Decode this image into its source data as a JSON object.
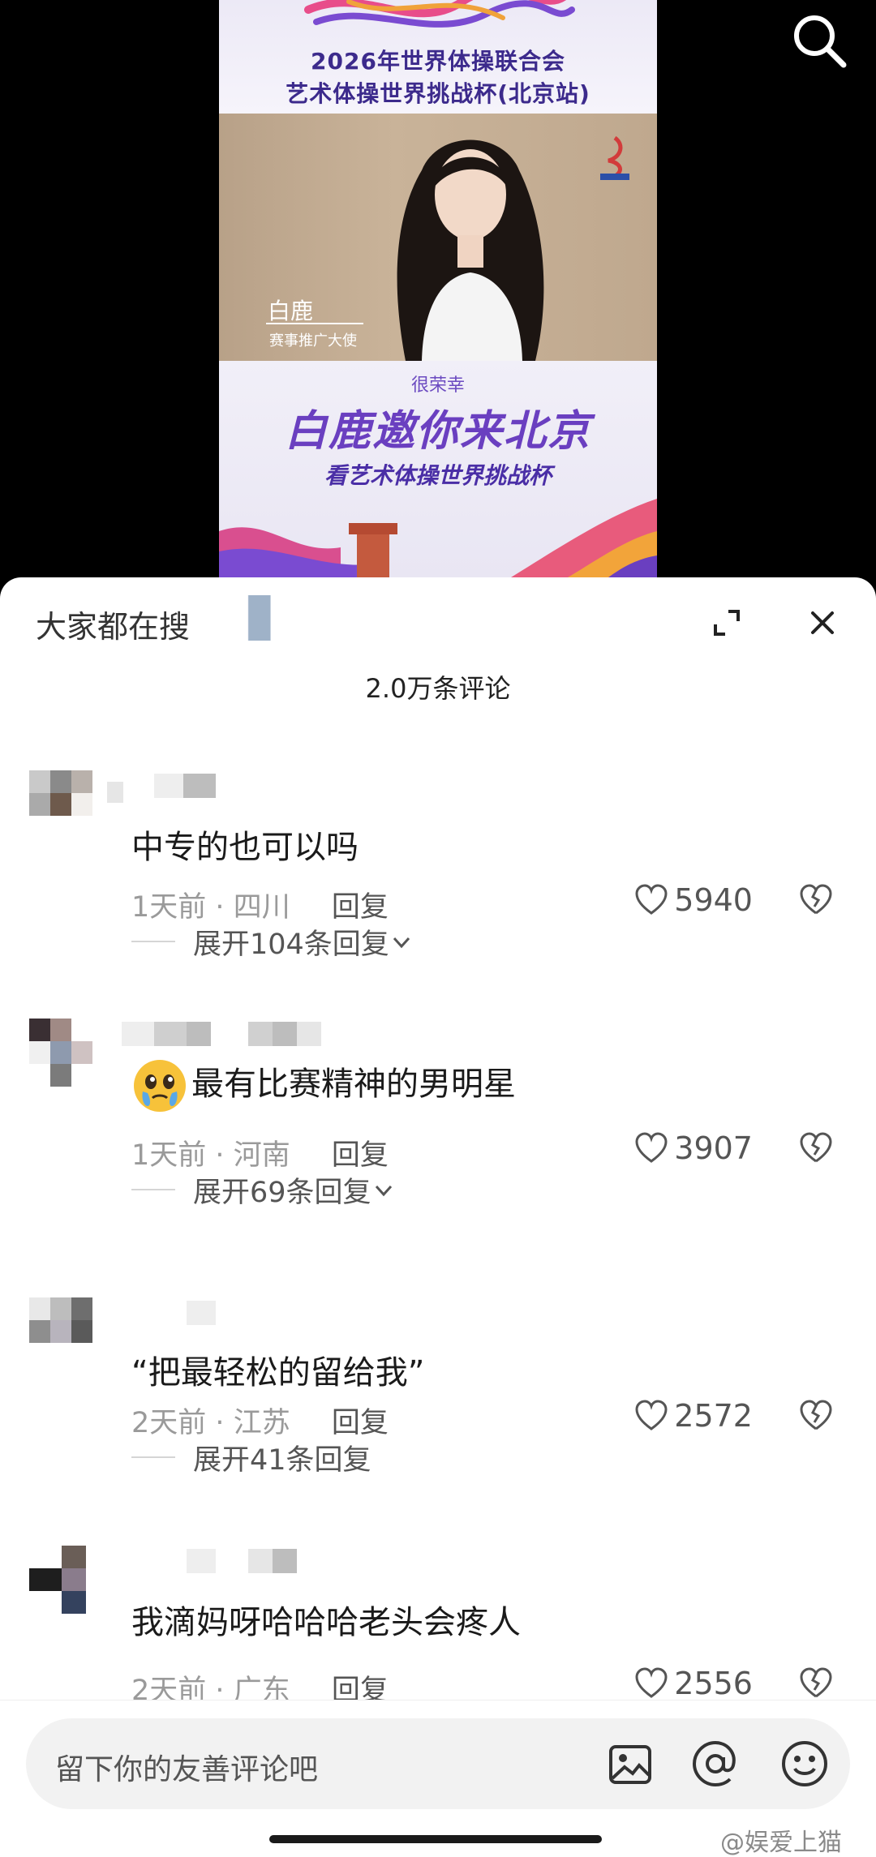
{
  "poster": {
    "title_line1": "2026年世界体操联合会",
    "title_line2": "艺术体操世界挑战杯(北京站)",
    "person_name": "白鹿",
    "person_role": "赛事推广大使",
    "invite_small": "很荣幸",
    "invite_big": "白鹿邀你来北京",
    "invite_mid": "看艺术体操世界挑战杯"
  },
  "sheet": {
    "hot_search_label": "大家都在搜",
    "comment_count": "2.0万条评论"
  },
  "comments": [
    {
      "text": "中专的也可以吗",
      "time": "1天前",
      "location": "四川",
      "reply_label": "回复",
      "likes": "5940",
      "expand_label": "展开104条回复"
    },
    {
      "text": "最有比赛精神的男明星",
      "emoji": "crying-face",
      "time": "1天前",
      "location": "河南",
      "reply_label": "回复",
      "likes": "3907",
      "expand_label": "展开69条回复"
    },
    {
      "text": "“把最轻松的留给我”",
      "time": "2天前",
      "location": "江苏",
      "reply_label": "回复",
      "likes": "2572",
      "expand_label": "展开41条回复"
    },
    {
      "text": "我滴妈呀哈哈哈老头会疼人",
      "time": "2天前",
      "location": "广东",
      "reply_label": "回复",
      "likes": "2556"
    }
  ],
  "input": {
    "placeholder": "留下你的友善评论吧"
  },
  "watermark": "@娱爱上猫",
  "colors": {
    "poster_purple": "#3c2a8c",
    "invite_purple": "#6a3fc0",
    "meta_gray": "#9a9a9a"
  }
}
